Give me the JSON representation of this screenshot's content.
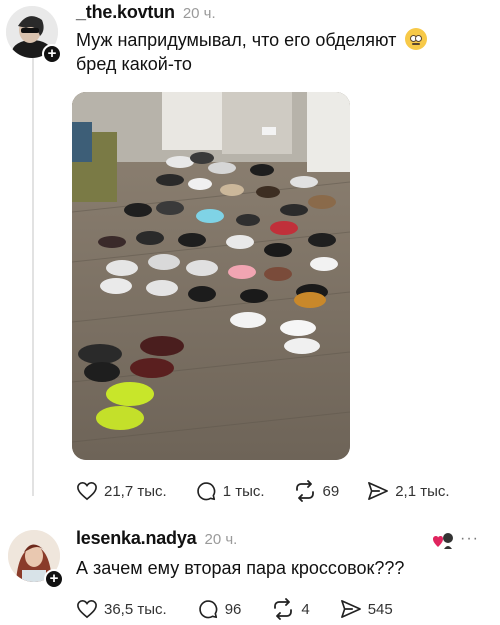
{
  "posts": [
    {
      "username": "_the.kovtun",
      "time": "20 ч.",
      "text": "Муж напридумывал, что его обделяют",
      "text_line2": "бред какой-то",
      "emoji": "rolling-eyes-emoji",
      "stats": {
        "likes": "21,7 тыс.",
        "comments": "1 тыс.",
        "reposts": "69",
        "shares": "2,1 тыс."
      }
    },
    {
      "username": "lesenka.nadya",
      "time": "20 ч.",
      "text": "А зачем ему вторая пара кроссовок???",
      "stats": {
        "likes": "36,5 тыс.",
        "comments": "96",
        "reposts": "4",
        "shares": "545"
      }
    }
  ],
  "icons": {
    "like": "heart-outline-icon",
    "comment": "comment-bubble-icon",
    "repost": "repost-arrows-icon",
    "share": "send-icon",
    "more": "more-dots-icon",
    "plus": "follow-plus-icon"
  },
  "more_label": "···",
  "plus_label": "+",
  "colors": {
    "accent_red": "#e0245e",
    "muted": "#9a9a9a",
    "text": "#111111"
  }
}
